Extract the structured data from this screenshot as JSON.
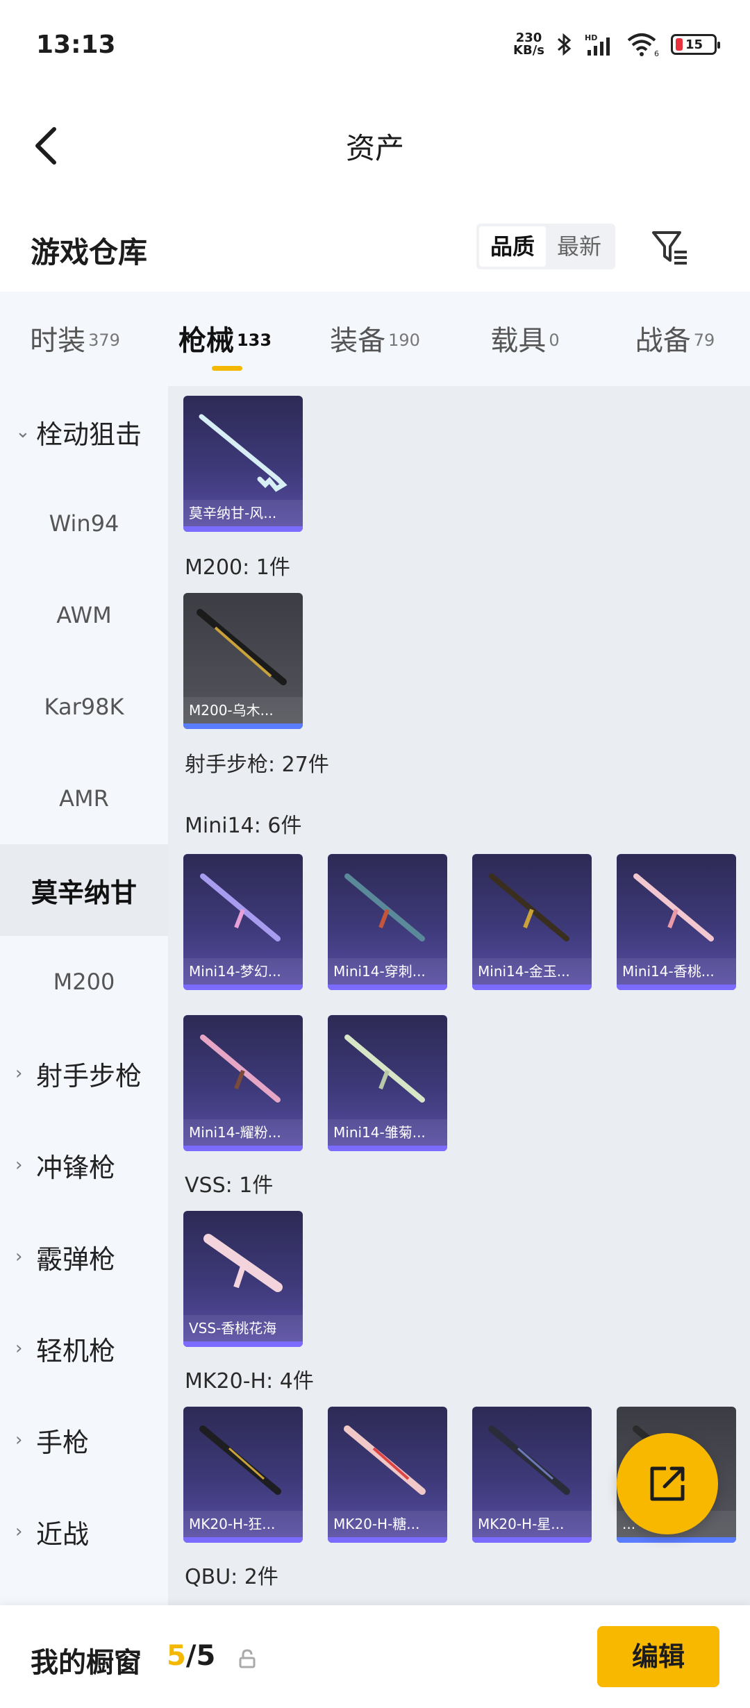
{
  "status_bar": {
    "time": "13:13",
    "net_speed_value": "230",
    "net_speed_unit": "KB/s",
    "battery": "15",
    "wifi_badge": "6"
  },
  "header": {
    "title": "资产"
  },
  "warehouse": {
    "title": "游戏仓库",
    "sort_options": [
      "品质",
      "最新"
    ],
    "sort_active": "品质"
  },
  "tabs": [
    {
      "label": "时装",
      "count": "379"
    },
    {
      "label": "枪械",
      "count": "133",
      "active": true
    },
    {
      "label": "装备",
      "count": "190"
    },
    {
      "label": "载具",
      "count": "0"
    },
    {
      "label": "战备",
      "count": "79"
    }
  ],
  "sidebar": {
    "items": [
      {
        "label": "栓动狙击",
        "type": "category",
        "chevron": "down"
      },
      {
        "label": "Win94"
      },
      {
        "label": "AWM"
      },
      {
        "label": "Kar98K"
      },
      {
        "label": "AMR"
      },
      {
        "label": "莫辛纳甘",
        "selected": true
      },
      {
        "label": "M200"
      },
      {
        "label": "射手步枪",
        "type": "category",
        "chevron": "right"
      },
      {
        "label": "冲锋枪",
        "type": "category",
        "chevron": "right"
      },
      {
        "label": "霰弹枪",
        "type": "category",
        "chevron": "right"
      },
      {
        "label": "轻机枪",
        "type": "category",
        "chevron": "right"
      },
      {
        "label": "手枪",
        "type": "category",
        "chevron": "right"
      },
      {
        "label": "近战",
        "type": "category",
        "chevron": "right"
      }
    ]
  },
  "content": {
    "labels": {
      "m200": "M200: 1件",
      "marksman": "射手步枪: 27件",
      "mini14": "Mini14: 6件",
      "vss": "VSS: 1件",
      "mk20": "MK20-H: 4件",
      "qbu": "QBU: 2件"
    },
    "cards": {
      "mosin": "莫辛纳甘-风...",
      "m200": "M200-乌木...",
      "mini14": [
        "Mini14-梦幻...",
        "Mini14-穿刺...",
        "Mini14-金玉...",
        "Mini14-香桃...",
        "Mini14-耀粉...",
        "Mini14-雏菊..."
      ],
      "vss": "VSS-香桃花海",
      "mk20": [
        "MK20-H-狂...",
        "MK20-H-糖...",
        "MK20-H-星...",
        "..."
      ]
    }
  },
  "bottom_bar": {
    "label": "我的橱窗",
    "current": "5",
    "total": "/5",
    "edit_label": "编辑"
  },
  "colors": {
    "accent": "#f8b800",
    "card_purple": "#3e3a7a",
    "background": "#eaedf1"
  }
}
